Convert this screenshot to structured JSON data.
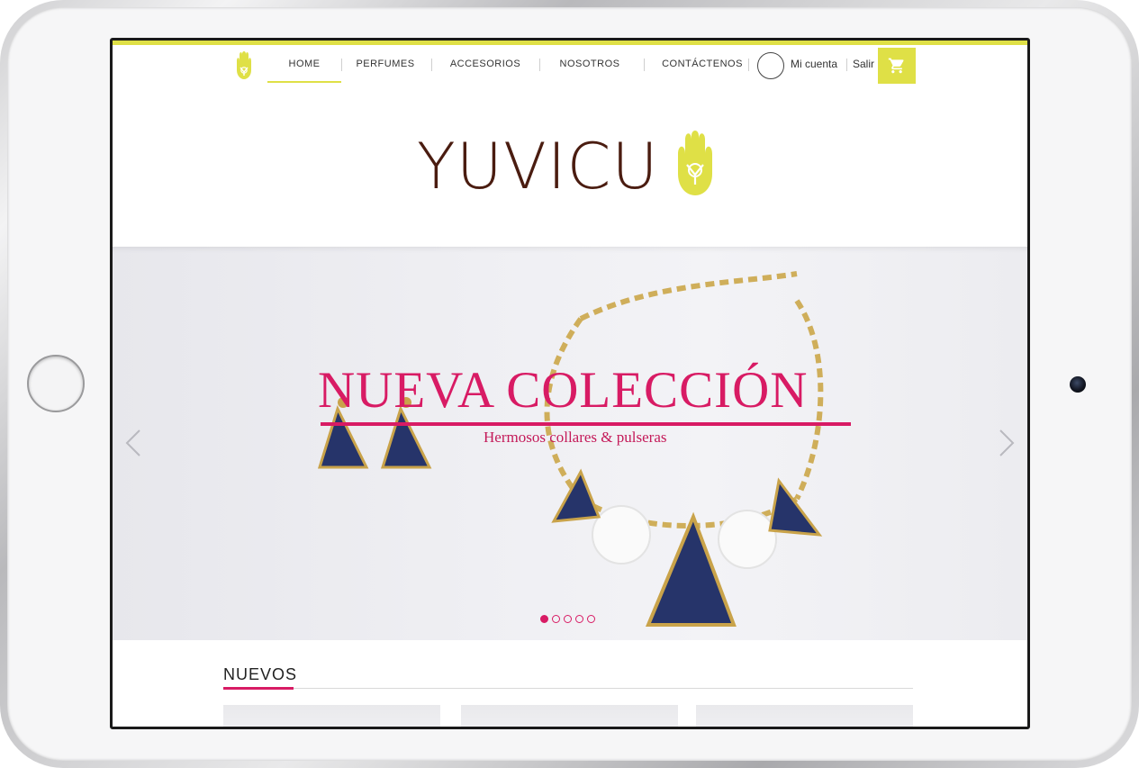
{
  "nav": {
    "items": [
      {
        "label": "HOME",
        "active": true
      },
      {
        "label": "PERFUMES",
        "active": false
      },
      {
        "label": "ACCESORIOS",
        "active": false
      },
      {
        "label": "NOSOTROS",
        "active": false
      },
      {
        "label": "CONTÁCTENOS",
        "active": false
      }
    ],
    "account_label": "Mi cuenta",
    "logout_label": "Salir",
    "cart_icon": "cart-icon"
  },
  "brand": {
    "name": "YUVICU",
    "logo_icon": "hamsa-hand-icon"
  },
  "hero": {
    "title": "NUEVA COLECCIÓN",
    "subtitle": "Hermosos collares & pulseras",
    "slide_count": 5,
    "active_slide": 1
  },
  "section": {
    "title": "NUEVOS"
  },
  "colors": {
    "accent_yellow": "#dfe046",
    "brand_brown": "#4a1c10",
    "hero_pink": "#d81b64"
  }
}
